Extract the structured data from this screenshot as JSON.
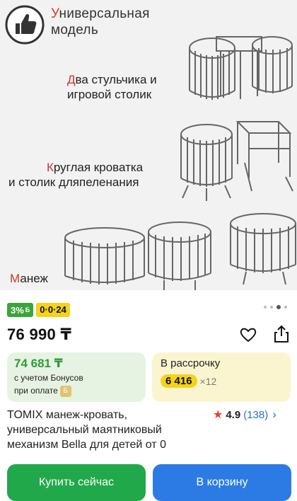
{
  "gallery": {
    "header_line1_first": "У",
    "header_line1_rest": "ниверсальная",
    "header_line2": "модель",
    "caption1_first": "Д",
    "caption1_rest": "ва стульчика и",
    "caption1_line2": "игровой столик",
    "caption2_first": "К",
    "caption2_rest": "руглая кроватка",
    "caption2_line2": "и столик дляпеленания",
    "caption3_first": "М",
    "caption3_rest": "анеж",
    "icon": "thumbs-up-icon"
  },
  "promo": {
    "discount": "3%",
    "discount_currency": "Б",
    "installment": "0·0·24"
  },
  "price": {
    "main": "76 990 ₸"
  },
  "bonus_card": {
    "amount": "74 681 ₸",
    "line1": "с учетом Бонусов",
    "line2": "при оплате"
  },
  "installment_card": {
    "title": "В рассрочку",
    "monthly": "6 416",
    "multiplier": "×12"
  },
  "product": {
    "title": "TOMIX манеж-кровать, универсальный маятниковый механизм Bella для детей от 0",
    "rating": "4.9",
    "reviews": "(138)"
  },
  "buttons": {
    "buy_now": "Купить сейчас",
    "add_to_cart": "В корзину"
  },
  "colors": {
    "green": "#21a84a",
    "blue": "#2c7be5",
    "yellow": "#f5d21b",
    "red_accent": "#d23a2a"
  }
}
